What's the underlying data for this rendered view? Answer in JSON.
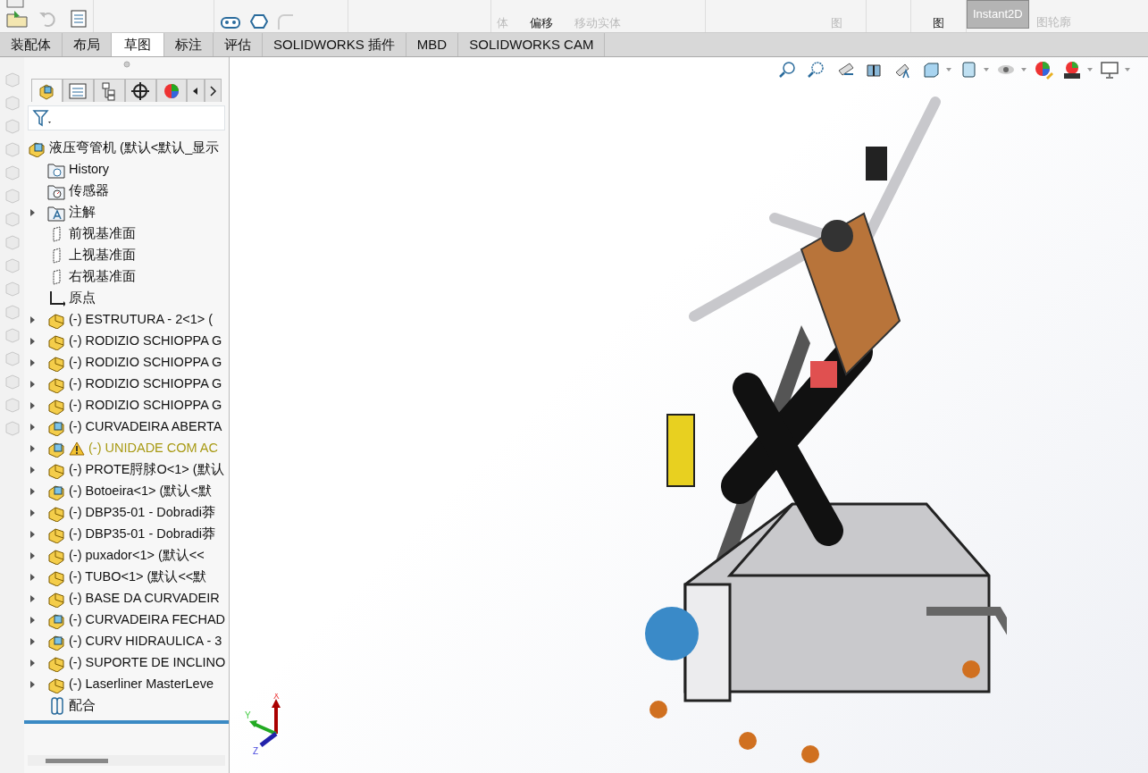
{
  "ribbon": {
    "labels": [
      "体",
      "偏移",
      "移动实体",
      "图",
      "图",
      "图轮廓"
    ],
    "toggle": {
      "label": "Instant2D",
      "on": true
    }
  },
  "command_tabs": [
    {
      "label": "装配体",
      "selected": false
    },
    {
      "label": "布局",
      "selected": false
    },
    {
      "label": "草图",
      "selected": true
    },
    {
      "label": "标注",
      "selected": false
    },
    {
      "label": "评估",
      "selected": false
    },
    {
      "label": "SOLIDWORKS 插件",
      "selected": false
    },
    {
      "label": "MBD",
      "selected": false
    },
    {
      "label": "SOLIDWORKS CAM",
      "selected": false
    }
  ],
  "panel_tabs": [
    {
      "kind": "feature-tree",
      "selected": true
    },
    {
      "kind": "property",
      "selected": false
    },
    {
      "kind": "configuration",
      "selected": false
    },
    {
      "kind": "dimxpert",
      "selected": false
    },
    {
      "kind": "display",
      "selected": false
    }
  ],
  "tree": {
    "root": "液压弯管机 (默认<默认_显示",
    "items": [
      {
        "label": "History",
        "kind": "history",
        "expandable": false,
        "warning": false
      },
      {
        "label": "传感器",
        "kind": "sensor",
        "expandable": false,
        "warning": false
      },
      {
        "label": "注解",
        "kind": "annotation",
        "expandable": true,
        "warning": false
      },
      {
        "label": "前视基准面",
        "kind": "plane",
        "expandable": false,
        "warning": false
      },
      {
        "label": "上视基准面",
        "kind": "plane",
        "expandable": false,
        "warning": false
      },
      {
        "label": "右视基准面",
        "kind": "plane",
        "expandable": false,
        "warning": false
      },
      {
        "label": "原点",
        "kind": "origin",
        "expandable": false,
        "warning": false
      },
      {
        "label": "(-) ESTRUTURA - 2<1> (",
        "kind": "part",
        "expandable": true,
        "warning": false
      },
      {
        "label": "(-) RODIZIO SCHIOPPA G",
        "kind": "part",
        "expandable": true,
        "warning": false
      },
      {
        "label": "(-) RODIZIO SCHIOPPA G",
        "kind": "part",
        "expandable": true,
        "warning": false
      },
      {
        "label": "(-) RODIZIO SCHIOPPA G",
        "kind": "part",
        "expandable": true,
        "warning": false
      },
      {
        "label": "(-) RODIZIO SCHIOPPA G",
        "kind": "part",
        "expandable": true,
        "warning": false
      },
      {
        "label": "(-) CURVADEIRA ABERTA",
        "kind": "assembly",
        "expandable": true,
        "warning": false
      },
      {
        "label": "(-) UNIDADE COM AC",
        "kind": "assembly",
        "expandable": true,
        "warning": true
      },
      {
        "label": "(-) PROTE脟脙O<1> (默认",
        "kind": "part",
        "expandable": true,
        "warning": false
      },
      {
        "label": "(-) Botoeira<1> (默认<默",
        "kind": "assembly",
        "expandable": true,
        "warning": false
      },
      {
        "label": "(-) DBP35-01 - Dobradi莽",
        "kind": "part",
        "expandable": true,
        "warning": false
      },
      {
        "label": "(-) DBP35-01 - Dobradi莽",
        "kind": "part",
        "expandable": true,
        "warning": false
      },
      {
        "label": "(-) puxador<1> (默认<<",
        "kind": "part",
        "expandable": true,
        "warning": false
      },
      {
        "label": "(-) TUBO<1> (默认<<默",
        "kind": "part",
        "expandable": true,
        "warning": false
      },
      {
        "label": "(-) BASE DA CURVADEIR",
        "kind": "part",
        "expandable": true,
        "warning": false
      },
      {
        "label": "(-) CURVADEIRA FECHAD",
        "kind": "assembly",
        "expandable": true,
        "warning": false
      },
      {
        "label": "(-) CURV HIDRAULICA - 3",
        "kind": "assembly",
        "expandable": true,
        "warning": false
      },
      {
        "label": "(-) SUPORTE DE INCLINO",
        "kind": "part",
        "expandable": true,
        "warning": false
      },
      {
        "label": "(-) Laserliner MasterLeve",
        "kind": "part",
        "expandable": true,
        "warning": false
      },
      {
        "label": "配合",
        "kind": "mates",
        "expandable": false,
        "warning": false
      }
    ]
  },
  "triad": {
    "x": "X",
    "y": "Y",
    "z": "Z"
  }
}
